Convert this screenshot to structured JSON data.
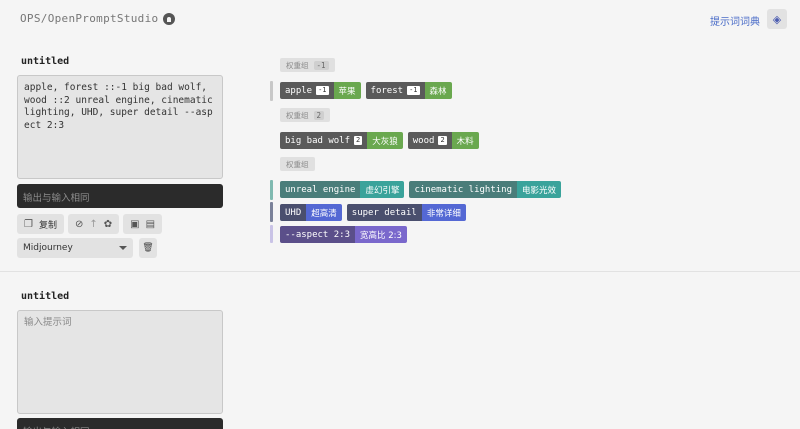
{
  "header": {
    "brand": "OPS/OpenPromptStudio",
    "dict_link": "提示词词典"
  },
  "editors": [
    {
      "title": "untitled",
      "prompt": "apple, forest ::-1 big bad wolf, wood ::2 unreal engine, cinematic lighting, UHD, super detail --aspect 2:3",
      "output_placeholder": "输出与输入相同",
      "copy_label": "复制",
      "model": "Midjourney"
    },
    {
      "title": "untitled",
      "placeholder": "输入提示词",
      "output_placeholder": "输出与输入相同"
    }
  ],
  "groups": [
    {
      "label": "权重组",
      "weight": "-1"
    },
    {
      "label": "权重组",
      "weight": "2"
    },
    {
      "label": "权重组",
      "weight": ""
    }
  ],
  "tags": {
    "apple": {
      "en": "apple",
      "weight": "-1",
      "zh": "苹果"
    },
    "forest": {
      "en": "forest",
      "weight": "-1",
      "zh": "森林"
    },
    "wolf": {
      "en": "big bad wolf",
      "weight": "2",
      "zh": "大灰狼"
    },
    "wood": {
      "en": "wood",
      "weight": "2",
      "zh": "木料"
    },
    "unreal": {
      "en": "unreal engine",
      "zh": "虚幻引擎"
    },
    "cinematic": {
      "en": "cinematic lighting",
      "zh": "电影光效"
    },
    "uhd": {
      "en": "UHD",
      "zh": "超高清"
    },
    "detail": {
      "en": "super detail",
      "zh": "非常详细"
    },
    "aspect": {
      "en": "--aspect 2:3",
      "zh": "宽高比 2:3"
    }
  },
  "colors": {
    "green_tag_en": "#5a5a5a",
    "green_tag_zh": "#6aa84f",
    "teal_tag_en": "#4a7d7a",
    "teal_tag_zh": "#3aa39b",
    "blue_tag_en": "#4a4f6e",
    "blue_tag_zh": "#5468d4",
    "purple_tag_en": "#5b4f8a",
    "purple_tag_zh": "#7a68cc"
  }
}
